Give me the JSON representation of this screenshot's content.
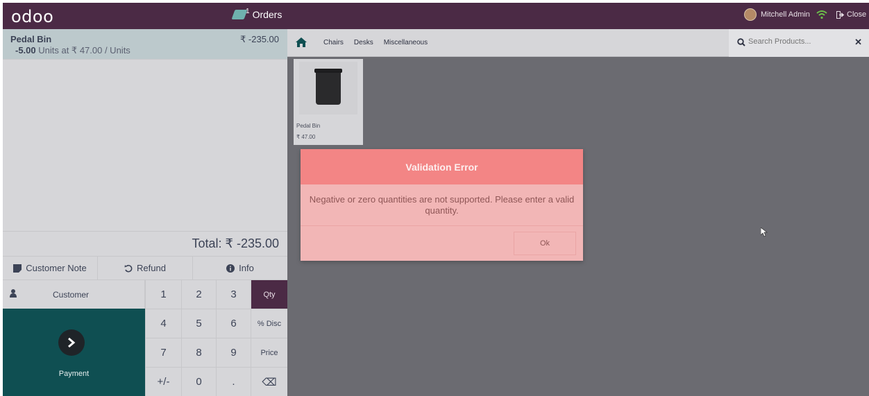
{
  "topbar": {
    "logo": "odoo",
    "orders_count": "1",
    "orders_label": "Orders",
    "user_name": "Mitchell Admin",
    "close_label": "Close"
  },
  "order": {
    "line": {
      "name": "Pedal Bin",
      "price": "₹ -235.00",
      "qty": "-5.00",
      "detail": " Units at ₹ 47.00 / Units"
    },
    "total": "Total: ₹ -235.00"
  },
  "controls": {
    "customer_note": "Customer Note",
    "refund": "Refund",
    "info": "Info"
  },
  "numpad": {
    "customer": "Customer",
    "payment": "Payment",
    "keys": [
      "1",
      "2",
      "3",
      "Qty",
      "4",
      "5",
      "6",
      "% Disc",
      "7",
      "8",
      "9",
      "Price",
      "+/-",
      "0",
      ".",
      "⌫"
    ],
    "active_mode": "Qty"
  },
  "categories": [
    "Chairs",
    "Desks",
    "Miscellaneous"
  ],
  "search": {
    "placeholder": "Search Products..."
  },
  "products": [
    {
      "name": "Pedal Bin",
      "price": "₹ 47.00"
    }
  ],
  "dialog": {
    "title": "Validation Error",
    "message": "Negative or zero quantities are not supported. Please enter a valid quantity.",
    "ok_label": "Ok"
  },
  "colors": {
    "topbar": "#4b2a45",
    "payment": "#0f4f52",
    "dialog_header": "#f38585",
    "dialog_body": "#f2b6b6"
  }
}
